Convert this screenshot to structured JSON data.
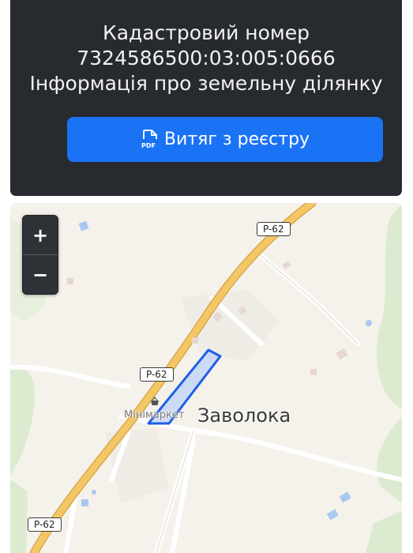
{
  "header": {
    "title_line1": "Кадастровий номер",
    "cadastral_number": "7324586500:03:005:0666",
    "title_line3": "Інформація про земельну ділянку"
  },
  "pdf_button": {
    "icon": "pdf-file-icon",
    "label": "Витяг з реєстру"
  },
  "map": {
    "zoom_in_label": "+",
    "zoom_out_label": "−",
    "road_labels": [
      "P-62",
      "P-62",
      "P-62"
    ],
    "place_name": "Заволока",
    "poi": {
      "icon": "shopping-basket-icon",
      "label": "Мінімаркет"
    },
    "parcel_color": "#1f5fe6",
    "parcel_fill": "#c5d6f7",
    "road_color": "#f3c766"
  },
  "colors": {
    "card_background": "#272a2e",
    "button_background": "#1a73f5",
    "map_background": "#f5f2ec",
    "green_area": "#dcebcf"
  }
}
